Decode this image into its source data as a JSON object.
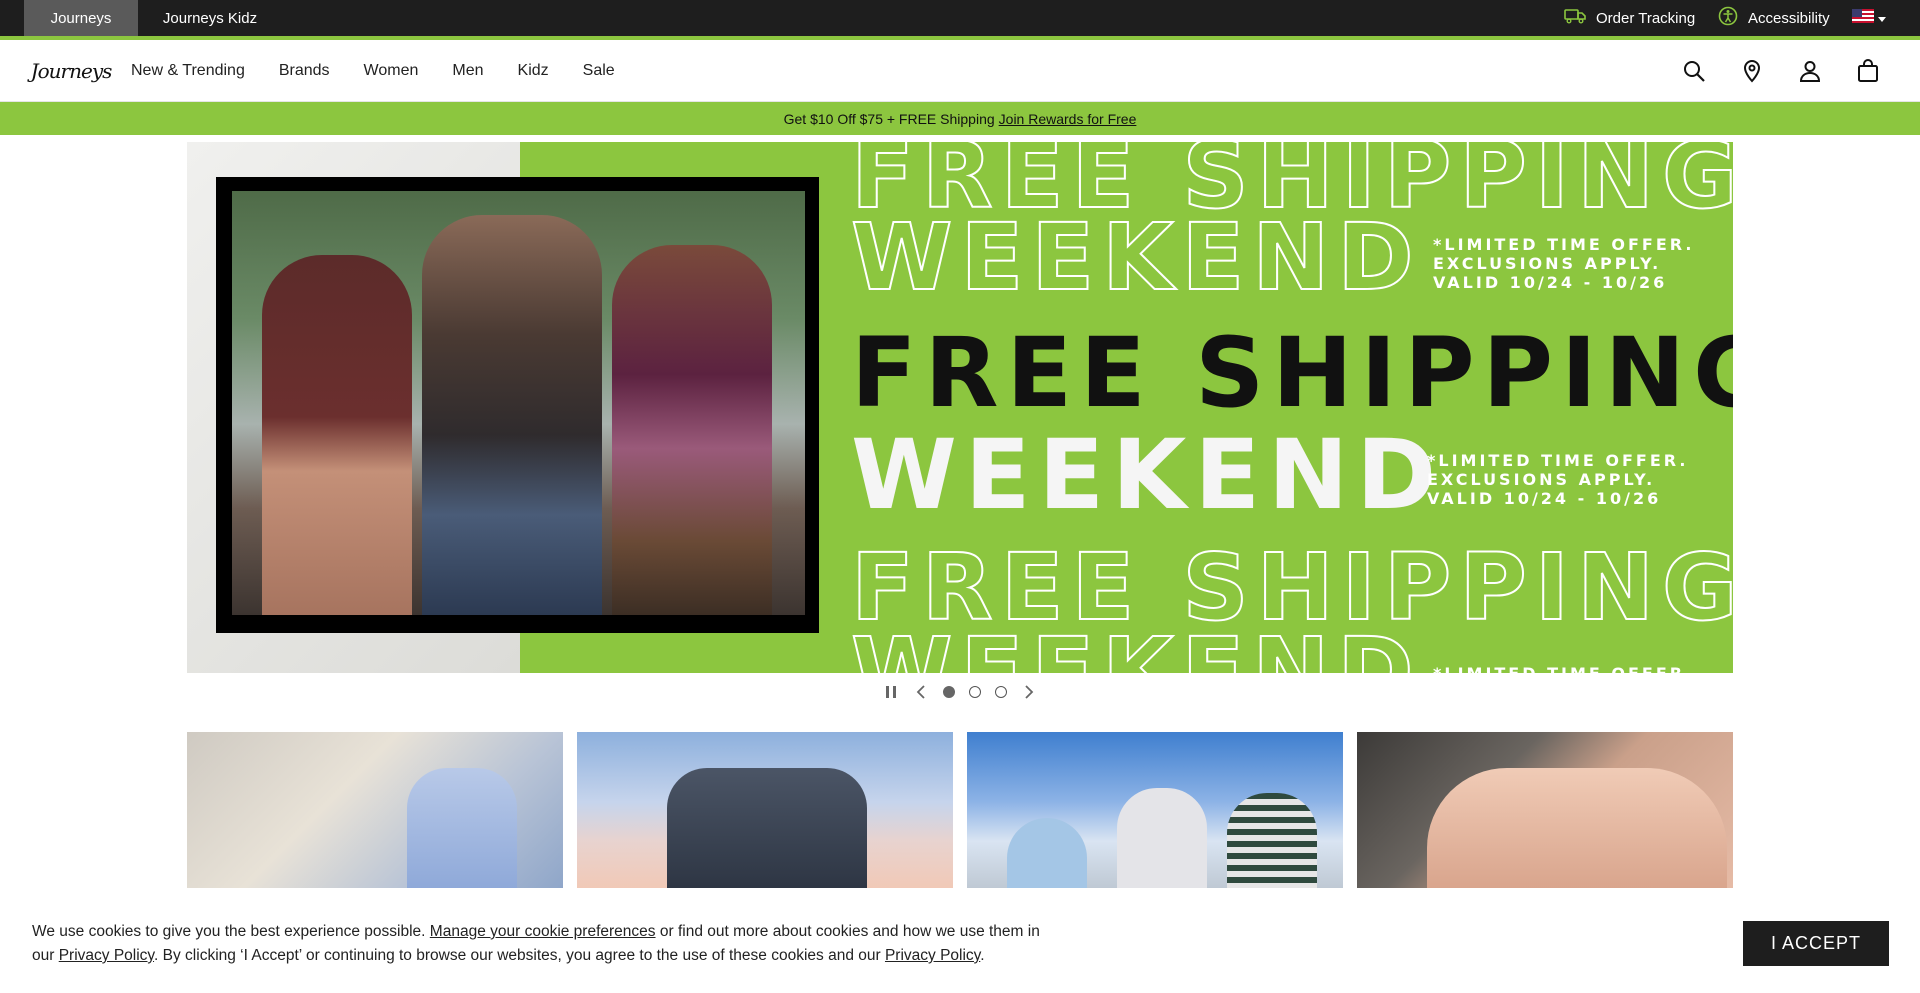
{
  "topbar": {
    "site_tabs": [
      "Journeys",
      "Journeys Kidz"
    ],
    "order_tracking": "Order Tracking",
    "accessibility": "Accessibility"
  },
  "nav": {
    "logo": "Journeys",
    "links": [
      "New & Trending",
      "Brands",
      "Women",
      "Men",
      "Kidz",
      "Sale"
    ]
  },
  "promo": {
    "text": "Get $10 Off $75 + FREE Shipping",
    "link": "Join Rewards for Free"
  },
  "hero": {
    "line_free_shipping": "FREE SHIPPING",
    "line_weekend": "WEEKEND",
    "fine_print": "*LIMITED TIME OFFER.\nEXCLUSIONS APPLY.\nVALID 10/24 - 10/26",
    "fine_print_partial": "*LIMITED TIME OFFER."
  },
  "carousel": {
    "slide_count": 3,
    "active_index": 0
  },
  "cookie": {
    "text_1": "We use cookies to give you the best experience possible.",
    "link_manage": "Manage your cookie preferences",
    "text_2": "or find out more about cookies and how we use them in our",
    "link_privacy_1": "Privacy Policy",
    "text_3": ". By clicking ‘I Accept’ or continuing to browse our websites, you agree to the use of these cookies and our",
    "link_privacy_2": "Privacy Policy",
    "text_4": ".",
    "accept": "I ACCEPT"
  },
  "colors": {
    "brand_green": "#8cc63f",
    "dark": "#1e1e1e"
  },
  "icons": [
    "truck-icon",
    "accessibility-icon",
    "us-flag-icon",
    "search-icon",
    "location-pin-icon",
    "account-icon",
    "bag-icon",
    "pause-icon",
    "chevron-left-icon",
    "chevron-right-icon"
  ]
}
